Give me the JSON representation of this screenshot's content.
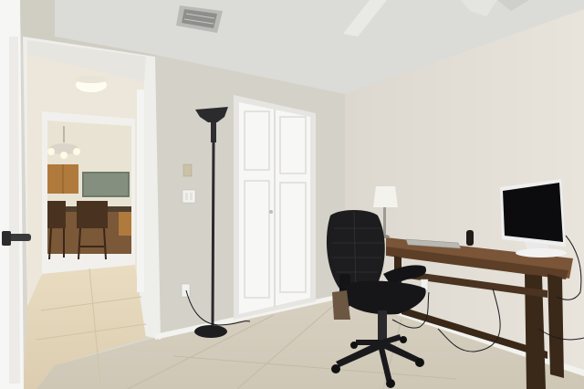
{
  "scene": {
    "subject": "home-office-room",
    "colors": {
      "ceiling": "#dcdcd8",
      "wall_left": "#d7d4cb",
      "wall_right": "#e2ded6",
      "floor": "#d8d2c3",
      "door": "#f3f3f1",
      "hall_floor": "#e4d6b8",
      "cabinet": "#b07a3c",
      "desk": "#6b4a2e",
      "chair": "#1b1b1d",
      "monitor_frame": "#f1f1f1",
      "screen": "#0c0c0e",
      "lamp_shade": "#f4f2ec"
    }
  }
}
